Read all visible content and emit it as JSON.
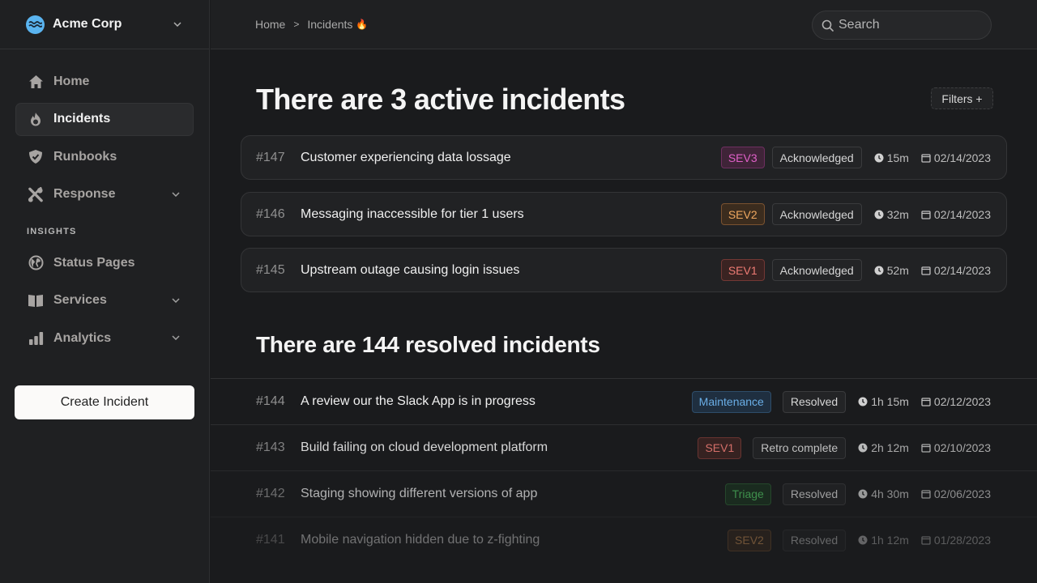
{
  "sidebar": {
    "org_name": "Acme Corp",
    "nav": [
      {
        "label": "Home",
        "icon": "home-icon"
      },
      {
        "label": "Incidents",
        "icon": "flame-icon",
        "active": true
      },
      {
        "label": "Runbooks",
        "icon": "shield-check-icon"
      },
      {
        "label": "Response",
        "icon": "tools-icon",
        "expandable": true
      }
    ],
    "section_label": "INSIGHTS",
    "insights": [
      {
        "label": "Status Pages",
        "icon": "globe-icon"
      },
      {
        "label": "Services",
        "icon": "book-icon",
        "expandable": true
      },
      {
        "label": "Analytics",
        "icon": "bar-chart-icon",
        "expandable": true
      }
    ],
    "create_button": "Create Incident"
  },
  "header": {
    "breadcrumb": [
      "Home",
      "Incidents"
    ],
    "breadcrumb_emoji": "🔥",
    "search_placeholder": "Search"
  },
  "main": {
    "active_heading": "There are 3 active incidents",
    "filters_label": "Filters +",
    "active_incidents": [
      {
        "id": "#147",
        "title": "Customer experiencing data lossage",
        "badge": "SEV3",
        "status": "Acknowledged",
        "duration": "15m",
        "date": "02/14/2023"
      },
      {
        "id": "#146",
        "title": "Messaging inaccessible for tier 1 users",
        "badge": "SEV2",
        "status": "Acknowledged",
        "duration": "32m",
        "date": "02/14/2023"
      },
      {
        "id": "#145",
        "title": "Upstream outage causing login issues",
        "badge": "SEV1",
        "status": "Acknowledged",
        "duration": "52m",
        "date": "02/14/2023"
      }
    ],
    "resolved_heading": "There are 144 resolved incidents",
    "resolved_incidents": [
      {
        "id": "#144",
        "title": "A review our the Slack App is in progress",
        "badge": "Maintenance",
        "status": "Resolved",
        "duration": "1h 15m",
        "date": "02/12/2023"
      },
      {
        "id": "#143",
        "title": "Build failing on cloud development platform",
        "badge": "SEV1",
        "status": "Retro complete",
        "duration": "2h 12m",
        "date": "02/10/2023"
      },
      {
        "id": "#142",
        "title": "Staging showing different versions of app",
        "badge": "Triage",
        "status": "Resolved",
        "duration": "4h 30m",
        "date": "02/06/2023"
      },
      {
        "id": "#141",
        "title": "Mobile navigation hidden due to z-fighting",
        "badge": "SEV2",
        "status": "Resolved",
        "duration": "1h 12m",
        "date": "01/28/2023"
      }
    ]
  },
  "colors": {
    "sev1": "#ee7b74",
    "sev2": "#f0a860",
    "sev3": "#e060c8",
    "maintenance": "#6aaee6",
    "triage": "#4ec060",
    "brand": "#5ab4f0"
  }
}
